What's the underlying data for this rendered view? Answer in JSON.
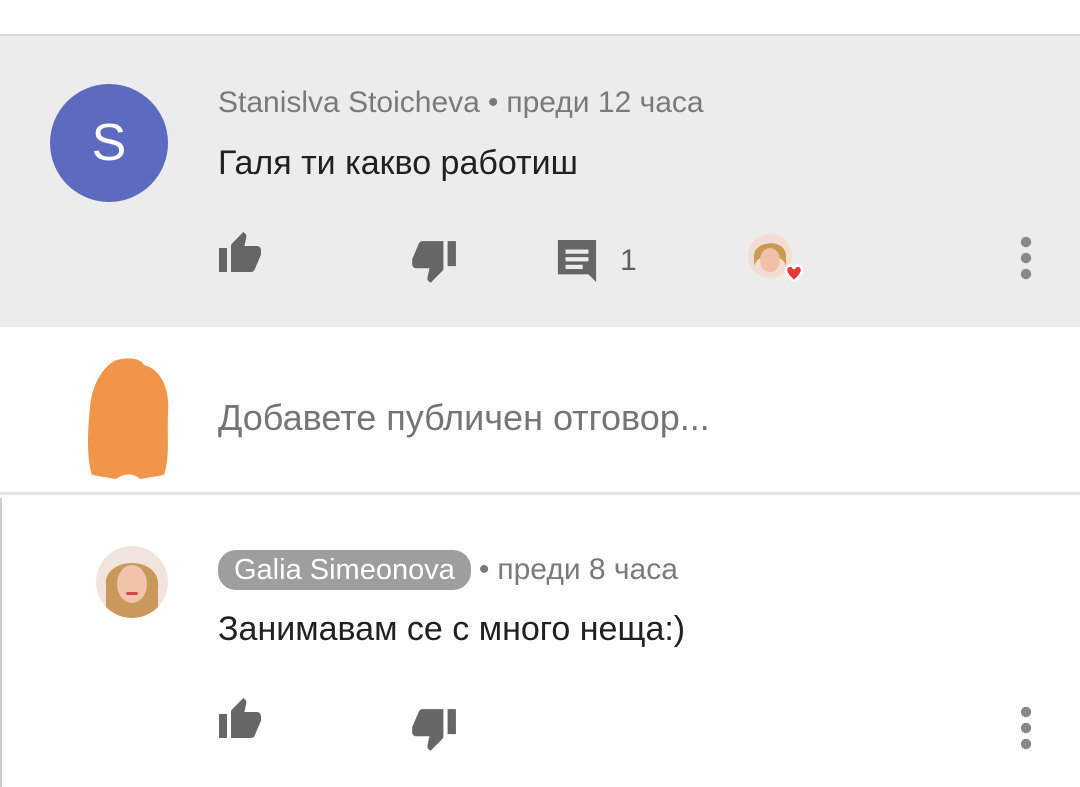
{
  "comment": {
    "avatar_letter": "S",
    "author": "Stanislva Stoicheva",
    "separator": "•",
    "time": "преди 12 часа",
    "text": "Галя ти какво работиш",
    "reply_count": "1",
    "actions": {
      "like_icon": "thumb-up-icon",
      "dislike_icon": "thumb-down-icon",
      "reply_icon": "comment-icon",
      "menu_icon": "more-vert-icon"
    },
    "colors": {
      "avatar_bg": "#5c6bc0",
      "heart": "#e53935"
    }
  },
  "reply_input": {
    "placeholder": "Добавете публичен отговор...",
    "avatar_color": "#f0954a"
  },
  "reply": {
    "author": "Galia Simeonova",
    "separator": "•",
    "time": "преди 8 часа",
    "text": "Занимавам се с много неща:)",
    "owner_badge_color": "#9e9e9e"
  }
}
